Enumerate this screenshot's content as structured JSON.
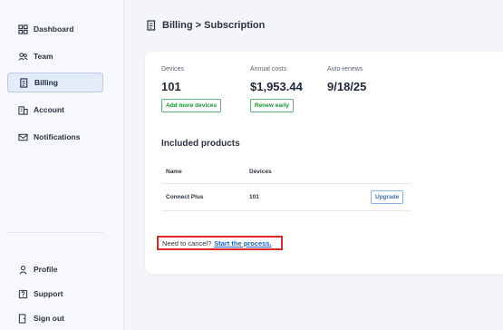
{
  "sidebar": {
    "items": [
      {
        "label": "Dashboard",
        "icon": "dashboard-icon"
      },
      {
        "label": "Team",
        "icon": "team-icon"
      },
      {
        "label": "Billing",
        "icon": "billing-icon",
        "active": true
      },
      {
        "label": "Account",
        "icon": "account-icon"
      },
      {
        "label": "Notifications",
        "icon": "mail-icon"
      }
    ],
    "bottom_items": [
      {
        "label": "Profile",
        "icon": "profile-icon"
      },
      {
        "label": "Support",
        "icon": "support-icon"
      },
      {
        "label": "Sign out",
        "icon": "sign-out-icon"
      }
    ]
  },
  "header": {
    "title": "Billing > Subscription"
  },
  "stats": [
    {
      "label": "Devices",
      "value": "101",
      "button": "Add more devices"
    },
    {
      "label": "Annual costs",
      "value": "$1,953.44",
      "button": "Renew early"
    },
    {
      "label": "Auto-renews",
      "value": "9/18/25"
    }
  ],
  "products": {
    "title": "Included products",
    "columns": [
      "Name",
      "Devices"
    ],
    "rows": [
      {
        "name": "Connect Plus",
        "devices": "101",
        "action": "Upgrade"
      }
    ]
  },
  "cancel": {
    "text": "Need to cancel?",
    "link": "Start the process."
  },
  "colors": {
    "accent": "#1f63c9",
    "highlight_box": "#e02828",
    "success": "#1e8a3a"
  }
}
